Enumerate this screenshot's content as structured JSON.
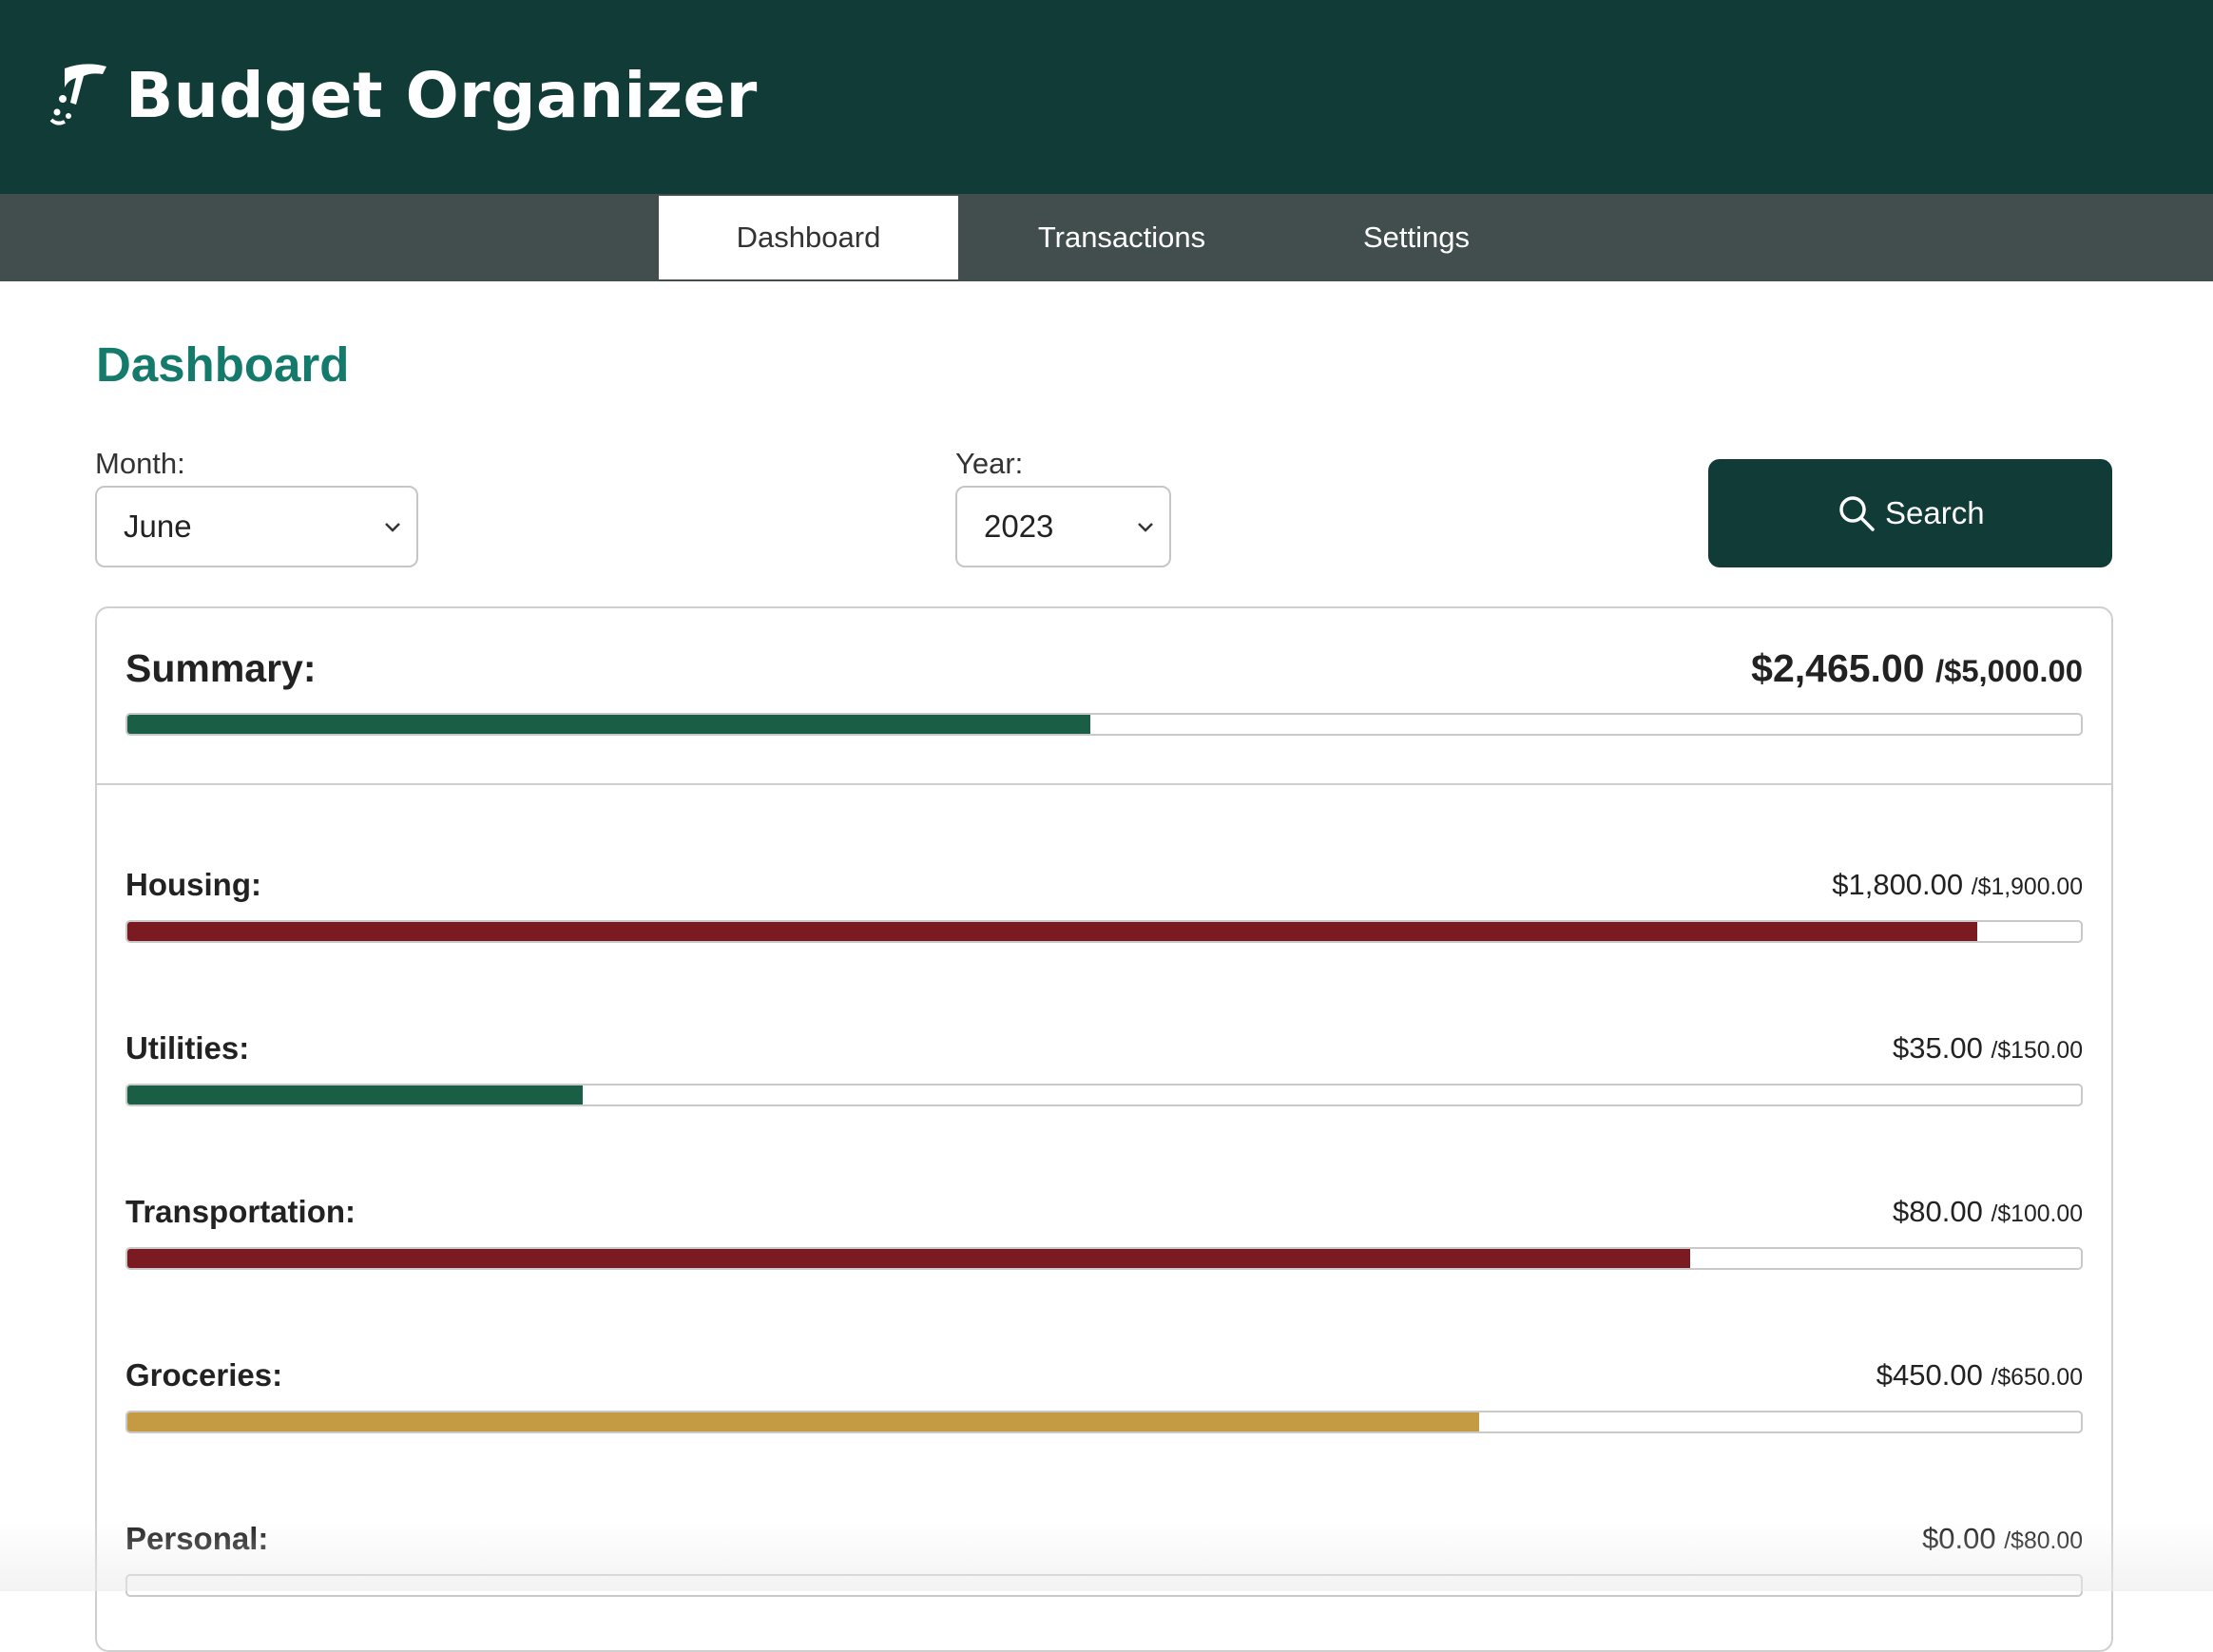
{
  "app": {
    "title": "Budget Organizer",
    "logo_icon": "pen-nib-icon"
  },
  "nav": {
    "tabs": [
      {
        "label": "Dashboard",
        "active": true
      },
      {
        "label": "Transactions",
        "active": false
      },
      {
        "label": "Settings",
        "active": false
      }
    ]
  },
  "page": {
    "title": "Dashboard"
  },
  "filters": {
    "month_label": "Month:",
    "month_value": "June",
    "year_label": "Year:",
    "year_value": "2023",
    "search_label": "Search",
    "search_icon": "search-icon"
  },
  "summary": {
    "label": "Summary:",
    "spent": "$2,465.00",
    "budget": "/$5,000.00",
    "fill_fraction": 0.493,
    "color": "#1a5e45"
  },
  "categories": [
    {
      "label": "Housing:",
      "spent": "$1,800.00",
      "budget": "/$1,900.00",
      "fill_fraction": 0.947,
      "color": "#7a1b21"
    },
    {
      "label": "Utilities:",
      "spent": "$35.00",
      "budget": "/$150.00",
      "fill_fraction": 0.233,
      "color": "#1a5e45"
    },
    {
      "label": "Transportation:",
      "spent": "$80.00",
      "budget": "/$100.00",
      "fill_fraction": 0.8,
      "color": "#7a1b21"
    },
    {
      "label": "Groceries:",
      "spent": "$450.00",
      "budget": "/$650.00",
      "fill_fraction": 0.692,
      "color": "#c49a42"
    },
    {
      "label": "Personal:",
      "spent": "$0.00",
      "budget": "/$80.00",
      "fill_fraction": 0,
      "color": "#1a5e45"
    }
  ],
  "colors": {
    "header_bg": "#103b37",
    "nav_bg": "#414e4d",
    "title_teal": "#137a6c",
    "over_budget": "#7a1b21",
    "under_budget": "#1a5e45",
    "warning": "#c49a42"
  }
}
